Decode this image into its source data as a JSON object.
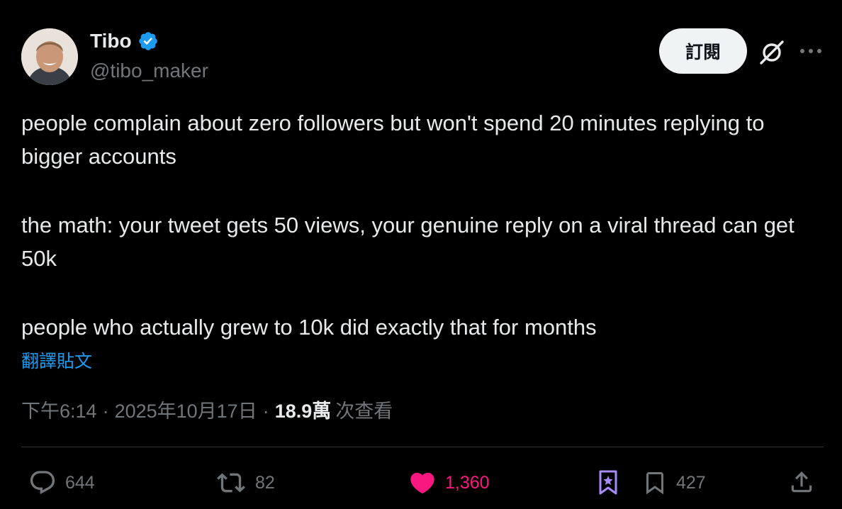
{
  "author": {
    "name": "Tibo",
    "handle": "@tibo_maker"
  },
  "header": {
    "subscribe_label": "訂閱"
  },
  "tweet": {
    "paragraphs": [
      "people complain about zero followers but won't spend 20 minutes replying to bigger accounts",
      "the math: your tweet gets 50 views, your genuine reply on a viral thread can get 50k",
      "people who actually grew to 10k did exactly that for months"
    ],
    "translate_label": "翻譯貼文"
  },
  "meta": {
    "time": "下午6:14",
    "date": "2025年10月17日",
    "views": "18.9萬",
    "views_suffix": "次查看"
  },
  "actions": {
    "replies": "644",
    "reposts": "82",
    "likes": "1,360",
    "bookmarks": "427"
  },
  "colors": {
    "background": "#000000",
    "text": "#e7e9ea",
    "muted": "#71767b",
    "link": "#1d9bf0",
    "like": "#f91880",
    "grok_accent": "#a78bfa"
  },
  "icons": [
    "avatar",
    "verified-badge-icon",
    "grok-icon",
    "more-icon",
    "reply-icon",
    "repost-icon",
    "heart-icon",
    "grok-bookmark-icon",
    "bookmark-icon",
    "share-icon"
  ]
}
